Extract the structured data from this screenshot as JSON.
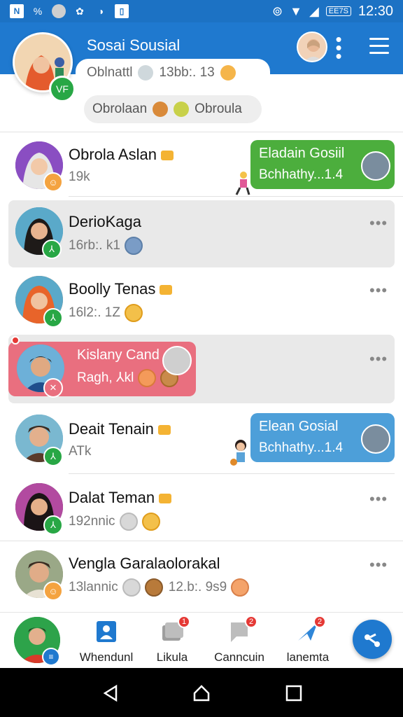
{
  "status_bar": {
    "time": "12:30",
    "battery_badge": "EE7S",
    "left_glyph": "%"
  },
  "header": {
    "title": "Sosai Sousial",
    "more_glyph": "⋮"
  },
  "profile": {
    "badge": "VF",
    "status_text": "Oblnattl",
    "status_meta": "13bb:. 13",
    "chip_left": "Obrolaan",
    "chip_right": "Obroula"
  },
  "chats": [
    {
      "name": "Obrola Aslan",
      "sub": "19k",
      "bubble_title": "Eladain Gosiil",
      "bubble_text": "Bchhathy...1.4"
    },
    {
      "name": "DerioKaga",
      "sub": "16rb:. k1",
      "more": "•••"
    },
    {
      "name": "Boolly Tenas",
      "sub": "16l2:. 1Z",
      "more": "•••"
    },
    {
      "name": "Kislany Cand",
      "sub": "Ragh, ⅄kl",
      "more": "•••"
    },
    {
      "name": "Deait Tenain",
      "sub": "ATk",
      "bubble_title": "Elean Gosial",
      "bubble_text": "Bchhathy...1.4"
    },
    {
      "name": "Dalat Teman",
      "sub": "192nnic",
      "more": "•••"
    },
    {
      "name": "Vengla Garalaolorakal",
      "sub": "13lannic",
      "sub2": "12.b:. 9s9",
      "more": "•••"
    }
  ],
  "bottom_nav": {
    "items": [
      {
        "label": "Whendunl",
        "badge": ""
      },
      {
        "label": "Likula",
        "badge": "1"
      },
      {
        "label": "Canncuin",
        "badge": "2"
      },
      {
        "label": "lanemta",
        "badge": "2"
      }
    ]
  },
  "colors": {
    "primary": "#1f79cf",
    "green": "#4cae3d",
    "blue_bubble": "#4d9fd9",
    "pink_bubble": "#e96f7f"
  }
}
